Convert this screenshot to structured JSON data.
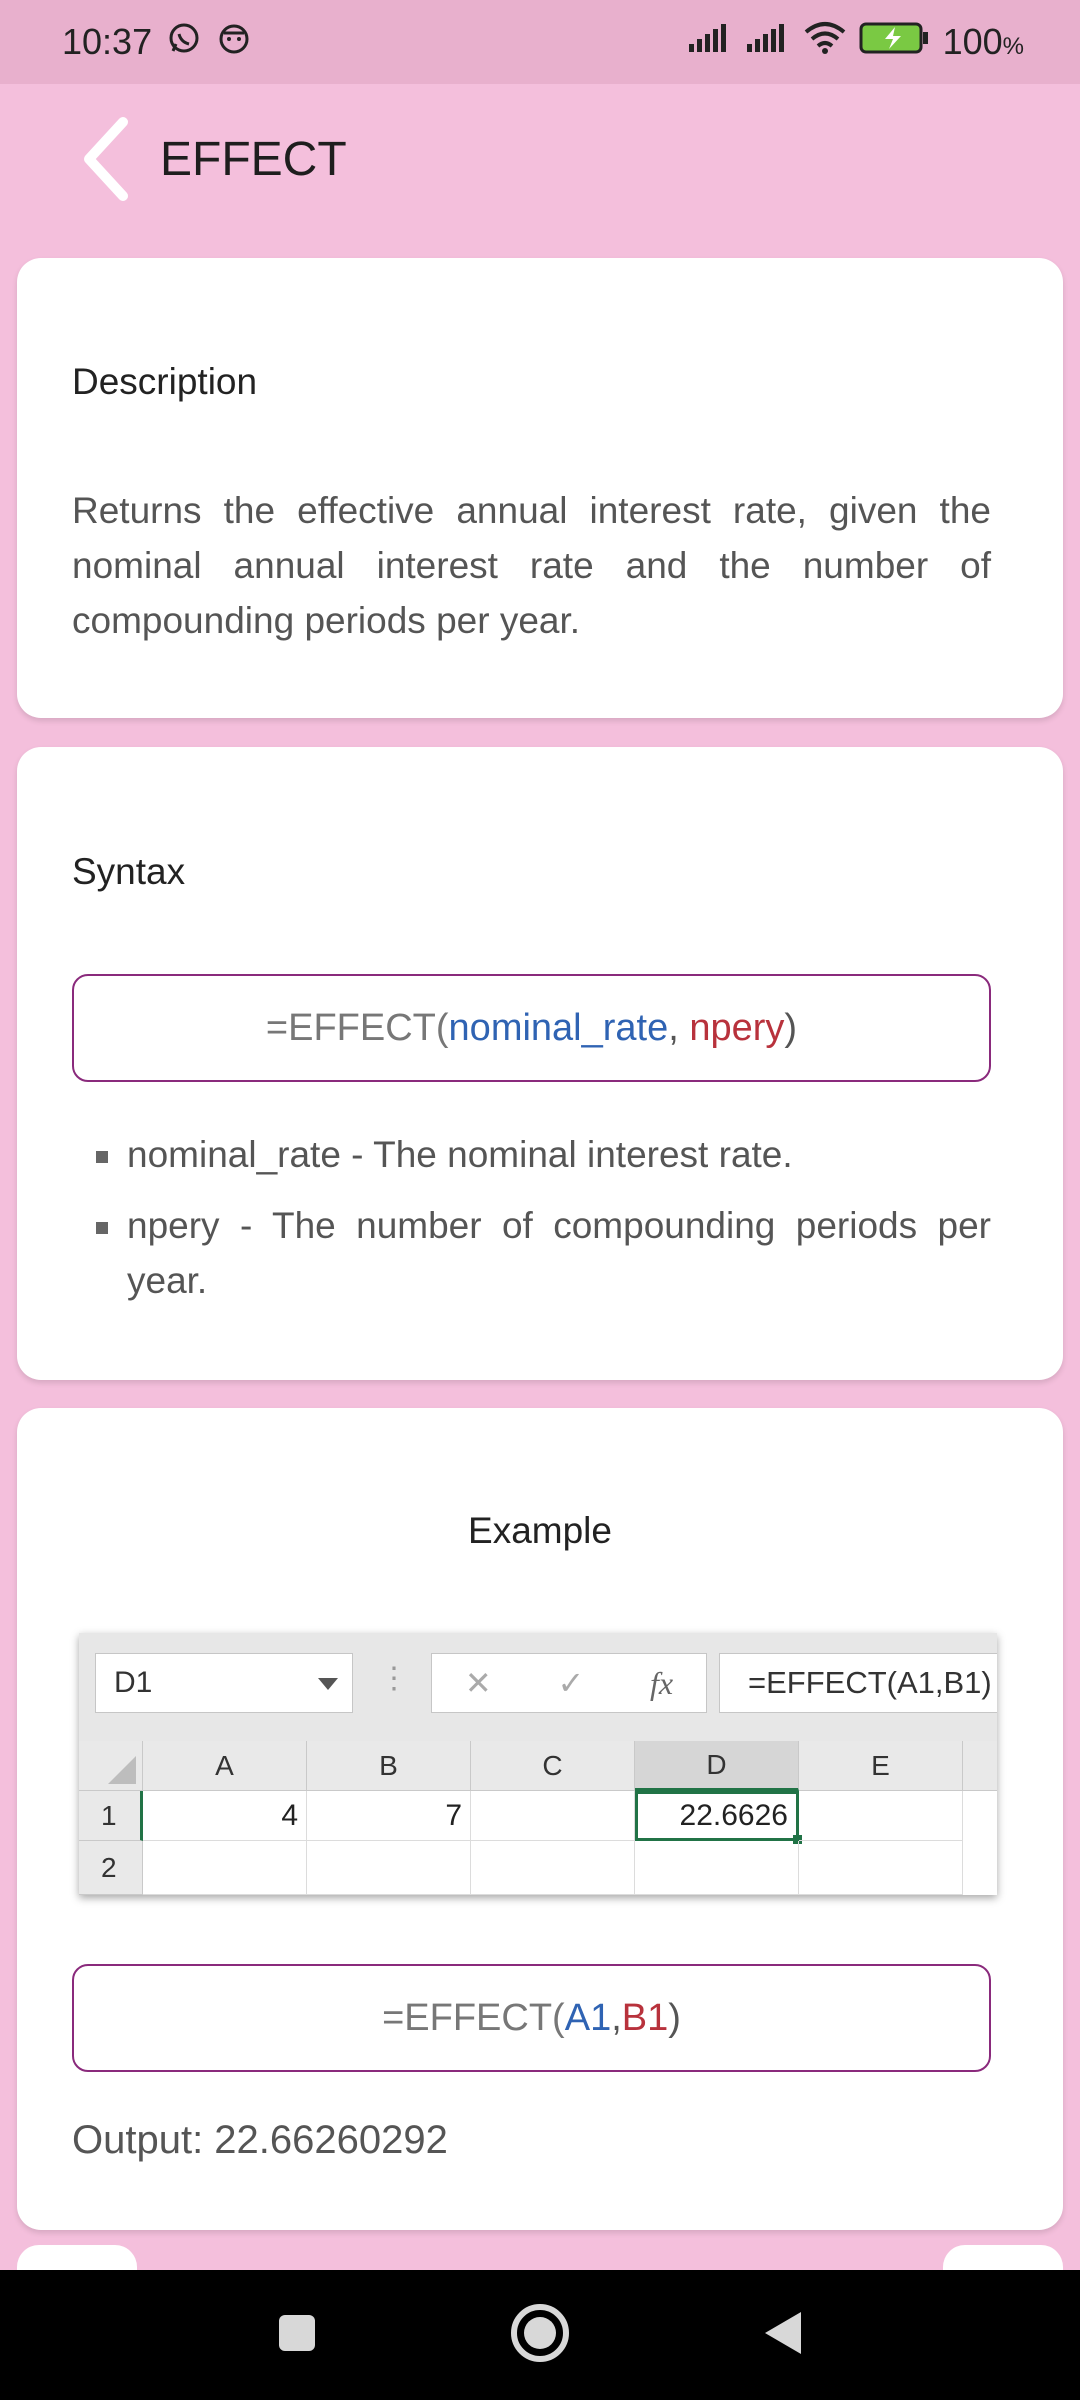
{
  "status_bar": {
    "time": "10:37",
    "battery": "100"
  },
  "app_bar": {
    "title": "EFFECT"
  },
  "description_card": {
    "heading": "Description",
    "text": "Returns the effective annual interest rate, given the nominal annual interest rate and the number of compounding periods per year."
  },
  "syntax_card": {
    "heading": "Syntax",
    "formula": {
      "prefix": "=EFFECT(",
      "arg1": "nominal_rate",
      "sep": ", ",
      "arg2": "npery",
      "suffix": ")"
    },
    "params": [
      {
        "text": "nominal_rate - The nominal interest rate."
      },
      {
        "text": "npery - The number of compounding periods per year."
      }
    ]
  },
  "example_card": {
    "heading": "Example",
    "spreadsheet": {
      "name_box": "D1",
      "formula_bar": "=EFFECT(A1,B1)",
      "fx_label": "fx",
      "columns": [
        "A",
        "B",
        "C",
        "D",
        "E"
      ],
      "rows": [
        "1",
        "2"
      ],
      "cells": {
        "A1": "4",
        "B1": "7",
        "D1": "22.6626"
      }
    },
    "formula": {
      "prefix": "=EFFECT(",
      "arg1": "A1",
      "sep": ",",
      "arg2": "B1",
      "suffix": ")"
    },
    "output": "Output: 22.66260292"
  },
  "colors": {
    "background": "#f4bfdc",
    "status_bar": "#e8b0cd",
    "arg_blue": "#2f63b3",
    "arg_red": "#b8323c",
    "border_purple": "#8a2a7c"
  }
}
